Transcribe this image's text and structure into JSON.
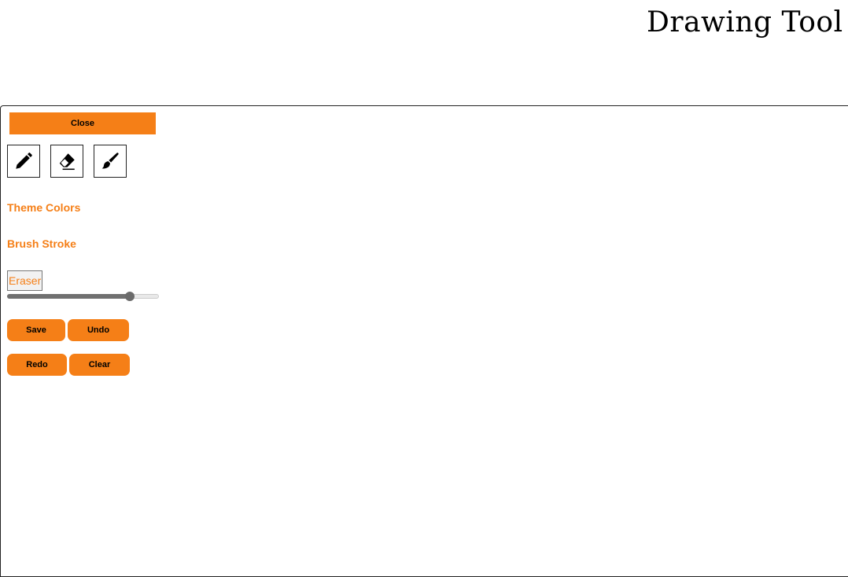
{
  "header": {
    "title": "Drawing Tool"
  },
  "panel": {
    "close_label": "Close",
    "tools": [
      {
        "name": "pencil-icon",
        "label": "Pencil"
      },
      {
        "name": "eraser-icon",
        "label": "Eraser"
      },
      {
        "name": "brush-icon",
        "label": "Brush"
      }
    ],
    "theme_colors_label": "Theme Colors",
    "brush_stroke_label": "Brush Stroke",
    "eraser_label": "Eraser",
    "slider_level": 0.81,
    "actions": {
      "save": "Save",
      "undo": "Undo",
      "redo": "Redo",
      "clear": "Clear"
    }
  },
  "colors": {
    "accent": "#f57f17",
    "icon": "#000000",
    "slider_fill": "#707070"
  }
}
